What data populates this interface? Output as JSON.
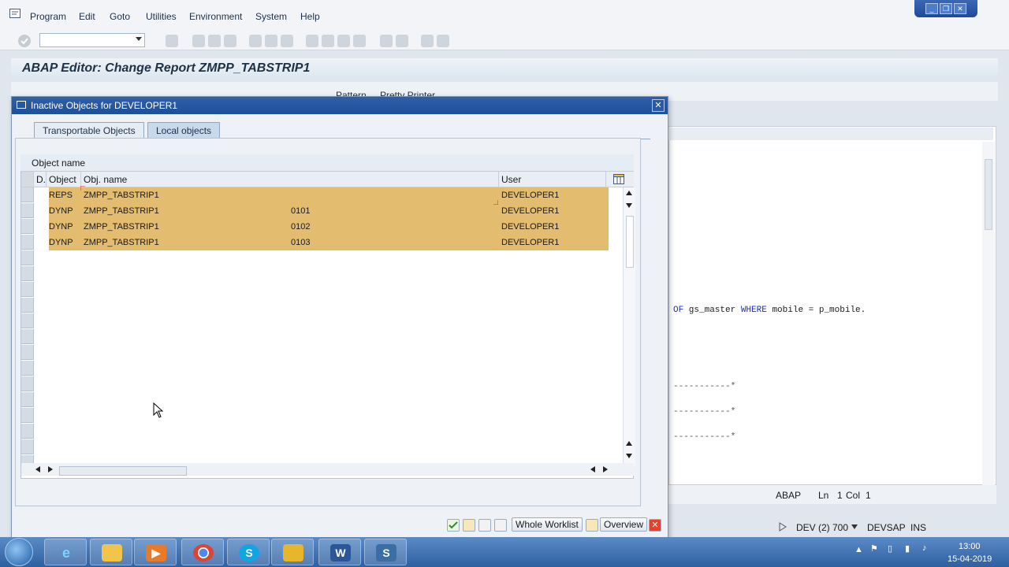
{
  "menubar": {
    "items": [
      "Program",
      "Edit",
      "Goto",
      "Utilities",
      "Environment",
      "System",
      "Help"
    ]
  },
  "editor": {
    "title": "ABAP Editor: Change Report ZMPP_TABSTRIP1",
    "toolbar_labels": [
      "Pattern",
      "Pretty Printer"
    ],
    "code_lines": [
      {
        "kw1": "OF",
        "txt1": " gs_master ",
        "kw2": "WHERE",
        "txt2": " mobile = p_mobile."
      },
      {
        "txt": "-----------*"
      },
      {
        "txt": "-----------*"
      },
      {
        "txt": "-----------*"
      }
    ],
    "status": {
      "lang": "ABAP",
      "ln_label": "Ln",
      "ln": "1",
      "col_label": "Col",
      "col": "1"
    }
  },
  "statusbar": {
    "system": "DEV (2) 700",
    "server": "DEVSAP",
    "mode": "INS"
  },
  "dialog": {
    "title": "Inactive Objects for DEVELOPER1",
    "tabs": [
      "Transportable Objects",
      "Local objects"
    ],
    "active_tab": 1,
    "grid_title": "Object name",
    "columns": [
      "D..",
      "Object",
      "Obj. name",
      "User"
    ],
    "rows": [
      {
        "object": "REPS",
        "name": "ZMPP_TABSTRIP1",
        "sub": "",
        "user": "DEVELOPER1"
      },
      {
        "object": "DYNP",
        "name": "ZMPP_TABSTRIP1",
        "sub": "0101",
        "user": "DEVELOPER1"
      },
      {
        "object": "DYNP",
        "name": "ZMPP_TABSTRIP1",
        "sub": "0102",
        "user": "DEVELOPER1"
      },
      {
        "object": "DYNP",
        "name": "ZMPP_TABSTRIP1",
        "sub": "0103",
        "user": "DEVELOPER1"
      }
    ],
    "buttons": {
      "whole_worklist": "Whole Worklist",
      "overview": "Overview"
    }
  },
  "taskbar": {
    "time": "13:00",
    "date": "15-04-2019"
  },
  "colors": {
    "row_highlight": "#e3bc6f",
    "dialog_title": "#1f4f97",
    "taskbar": "#2e5f9f"
  }
}
